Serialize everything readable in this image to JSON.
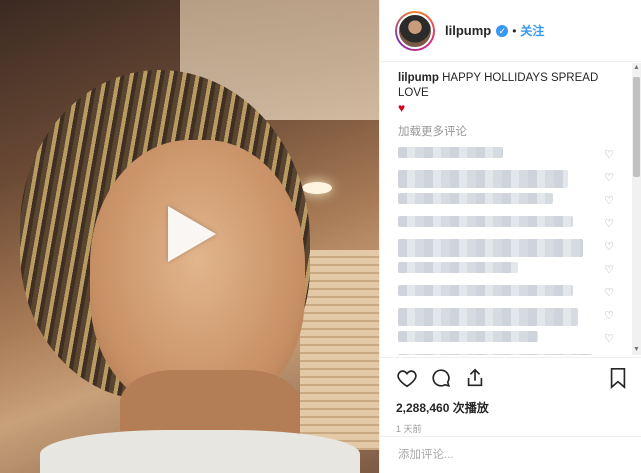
{
  "post": {
    "username": "lilpump",
    "verified_symbol": "✓",
    "separator": "•",
    "follow_label": "关注",
    "caption_user": "lilpump",
    "caption_text": "HAPPY HOLLIDAYS SPREAD LOVE",
    "caption_emoji": "♥",
    "load_more": "加载更多评论",
    "views": "2,288,460 次播放",
    "time": "1 天前",
    "add_comment_placeholder": "添加评论...",
    "comment_count": 10
  },
  "colors": {
    "accent": "#3897f0",
    "heart": "#d0021b"
  },
  "icons": {
    "like": "heart-outline-icon",
    "comment": "speech-bubble-icon",
    "share": "share-icon",
    "save": "bookmark-icon",
    "play": "play-icon"
  }
}
